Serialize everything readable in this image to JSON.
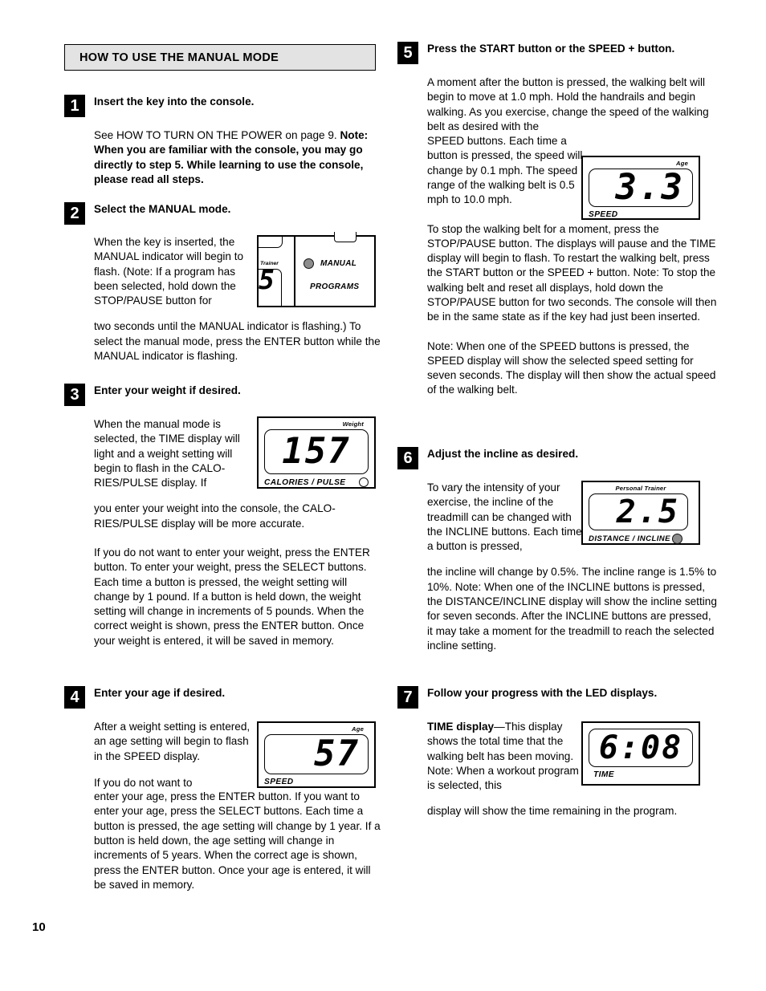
{
  "page": {
    "number": "10",
    "section_title": "HOW TO USE THE MANUAL MODE"
  },
  "steps": [
    {
      "number": "1",
      "heading": "Insert the key into the console.",
      "paragraphs": [
        "See HOW TO TURN ON THE POWER on page 9. ",
        "Note: When you are familiar with the console, you may go directly to step 5. While learning to use the console, please read all steps."
      ]
    },
    {
      "number": "2",
      "heading": "Select the MANUAL mode.",
      "para_wrap": "When the key is inserted, the MANUAL indicator will begin to flash. (Note: If a program has been selected, hold down the STOP/PAUSE button for",
      "para_full": "two seconds until the MANUAL indicator is flashing.) To select the manual mode, press the ENTER button while the MANUAL indicator is flashing."
    },
    {
      "number": "3",
      "heading": "Enter your weight if desired.",
      "para_wrap": "When the manual mode is selected, the TIME display will light and a weight setting will begin to flash in the CALO-RIES/PULSE display. If",
      "para_full": "you enter your weight into the console, the CALO-RIES/PULSE display will be more accurate.",
      "para_second": "If you do not want to enter your weight, press the ENTER button. To enter your weight, press the SELECT buttons. Each time a button is pressed, the weight setting will change by 1 pound. If a button is held down, the weight setting will change in increments of 5 pounds. When the correct weight is shown, press the ENTER button. Once your weight is entered, it will be saved in memory."
    },
    {
      "number": "4",
      "heading": "Enter your age if desired.",
      "para_wrap": "After a weight setting is entered, an age setting will begin to flash in the SPEED display.",
      "para_wrap2": "If you do not want to",
      "para_full": "enter your age, press the ENTER button. If you want to enter your age, press the SELECT buttons. Each time a button is pressed, the age setting will change by 1 year. If a button is held down, the age setting will change in increments of 5 years. When the correct age is shown, press the ENTER button. Once your age is entered, it will be saved in memory."
    },
    {
      "number": "5",
      "heading": "Press the START button or the SPEED + button.",
      "para_full_top": "A moment after the button is pressed, the walking belt will begin to move at 1.0 mph. Hold the handrails and begin walking. As you exercise, change the speed of the walking belt as desired with the",
      "para_wrap": "SPEED buttons. Each time a button is pressed, the speed will change by 0.1 mph. The speed range of the walking belt is 0.5 mph to 10.0 mph.",
      "para_second": "To stop the walking belt for a moment, press the STOP/PAUSE button. The displays will pause and the TIME display will begin to flash. To restart the walking belt, press the START button or the SPEED + button. Note: To stop the walking belt and reset all displays, hold down the STOP/PAUSE button for two seconds. The console will then be in the same state as if the key had just been inserted.",
      "para_third": "Note: When one of the SPEED buttons is pressed, the SPEED display will show the selected speed setting for seven seconds. The display will then show the actual speed of the walking belt."
    },
    {
      "number": "6",
      "heading": "Adjust the incline as desired.",
      "para_wrap": "To vary the intensity of your exercise, the incline of the treadmill can be changed with the INCLINE buttons. Each time a button is pressed,",
      "para_full": "the incline will change by 0.5%. The incline range is 1.5% to 10%. Note: When one of the INCLINE buttons is pressed, the DISTANCE/INCLINE display will show the incline setting for seven seconds. After the INCLINE buttons are pressed, it may take a moment for the treadmill to reach the selected incline setting."
    },
    {
      "number": "7",
      "heading": "Follow your progress with the LED displays.",
      "para_label": "TIME display",
      "para_wrap": "—This display shows the total time that the walking belt has been moving. Note: When a workout program is selected, this",
      "para_full": "display will show the time remaining in the program."
    }
  ],
  "figures": {
    "console": {
      "trainer_label": "Trainer",
      "partial_digit": "5",
      "manual_label": "MANUAL",
      "programs_label": "PROGRAMS"
    },
    "weight": {
      "top_label": "Weight",
      "value": "157",
      "bottom_label": "CALORIES / PULSE"
    },
    "age": {
      "top_label": "Age",
      "value": "57",
      "bottom_label": "SPEED"
    },
    "speed": {
      "top_label": "Age",
      "value": "3.3",
      "bottom_label": "SPEED"
    },
    "incline": {
      "top_label": "Personal Trainer",
      "value": "2.5",
      "bottom_label": "DISTANCE / INCLINE"
    },
    "time": {
      "top_label": "",
      "value": "6:08",
      "bottom_label": "TIME"
    }
  }
}
